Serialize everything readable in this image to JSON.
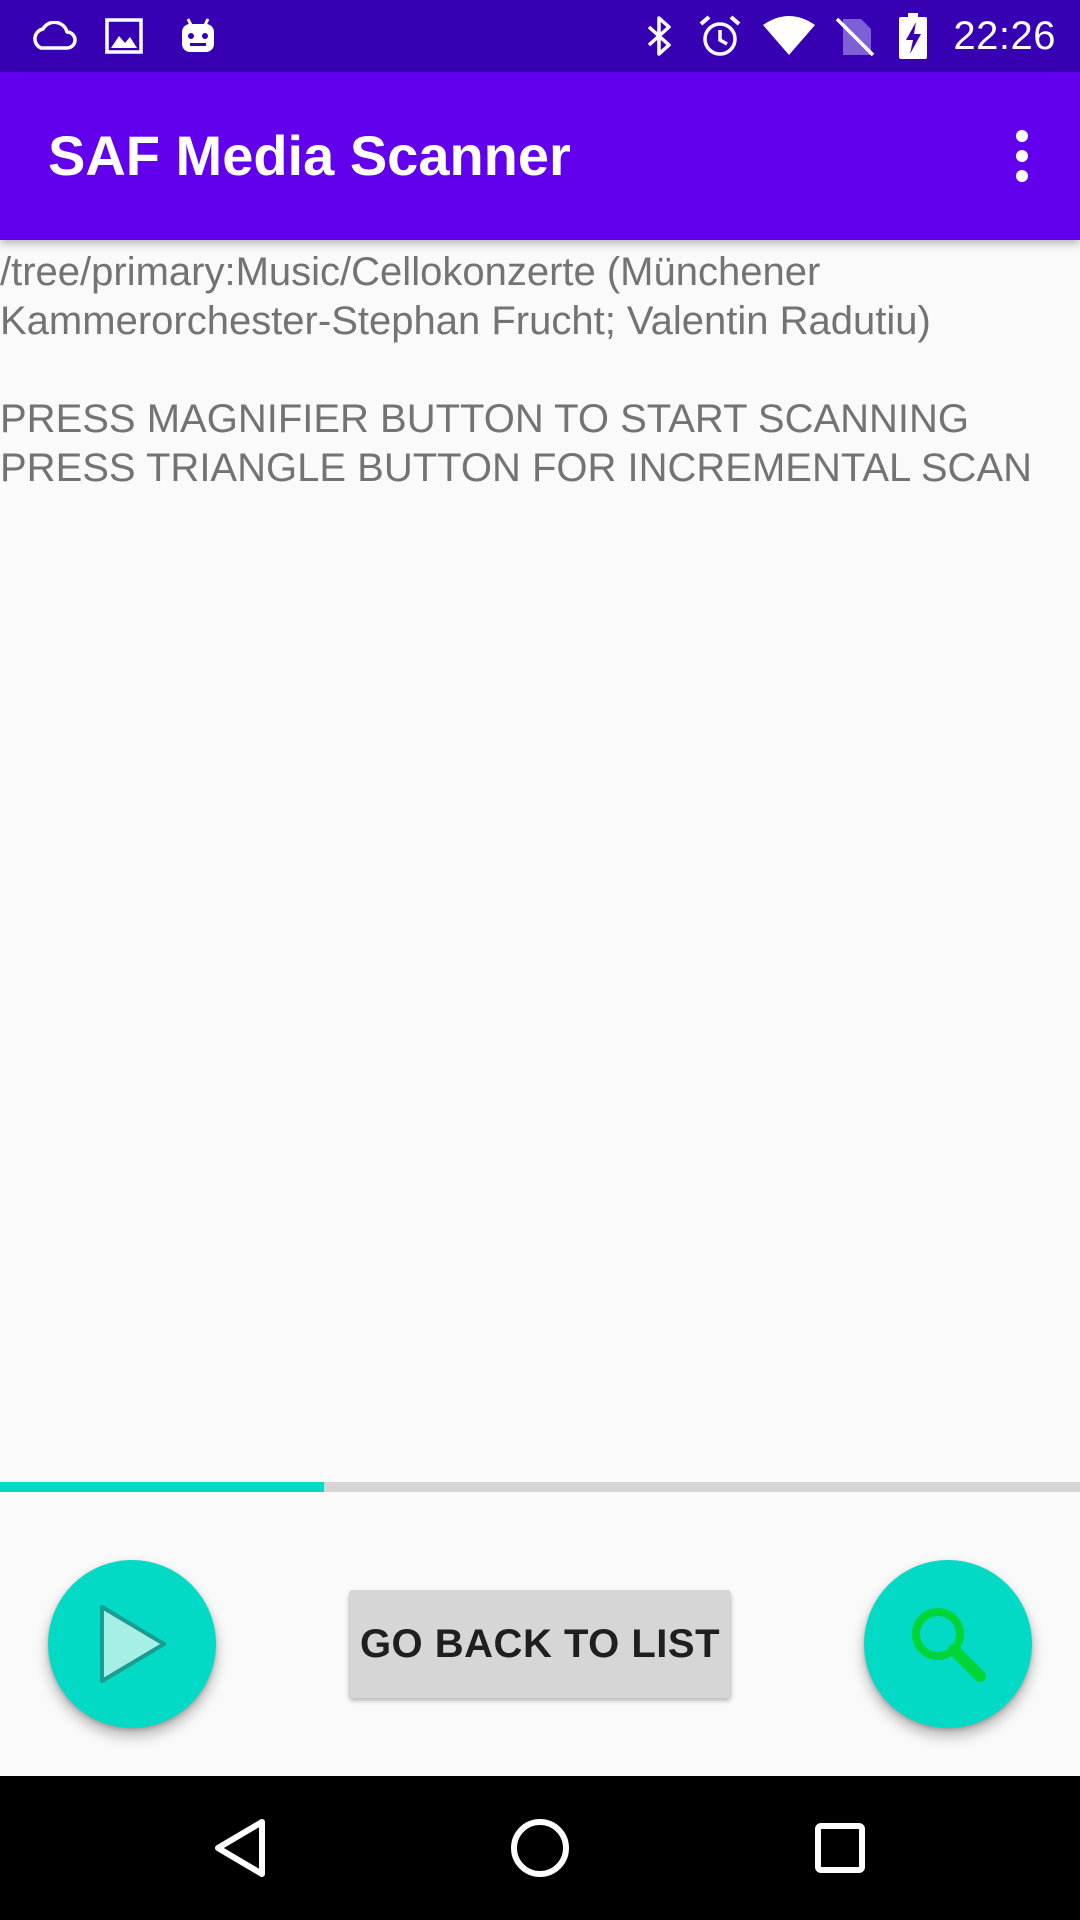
{
  "status_bar": {
    "time": "22:26",
    "left_icons": [
      "cloud-icon",
      "image-icon",
      "android-icon"
    ],
    "right_icons": [
      "bluetooth-icon",
      "alarm-icon",
      "wifi-icon",
      "no-sim-icon",
      "battery-charging-icon"
    ]
  },
  "app_bar": {
    "title": "SAF Media Scanner",
    "overflow_icon": "more-vert-icon"
  },
  "content": {
    "path_lines": [
      "/tree/primary:Music/Cellokonzerte (Münchener",
      "Kammerorchester-Stephan Frucht; Valentin Radutiu)"
    ],
    "instruction_lines": [
      "PRESS MAGNIFIER BUTTON TO START SCANNING",
      "PRESS TRIANGLE BUTTON FOR INCREMENTAL SCAN"
    ]
  },
  "progress": {
    "fraction": 0.3
  },
  "controls": {
    "play_icon": "play-triangle-icon",
    "back_button_label": "GO BACK TO LIST",
    "search_icon": "magnifier-icon"
  },
  "nav_bar": {
    "icons": [
      "back-triangle-icon",
      "home-circle-icon",
      "recents-square-icon"
    ]
  },
  "colors": {
    "status_bar": "#3700B3",
    "app_bar": "#6200EE",
    "accent": "#03DAC5",
    "background": "#FAFAFA",
    "text_secondary": "#737373",
    "button_grey": "#D6D6D6",
    "magnifier_green": "#00D436"
  }
}
